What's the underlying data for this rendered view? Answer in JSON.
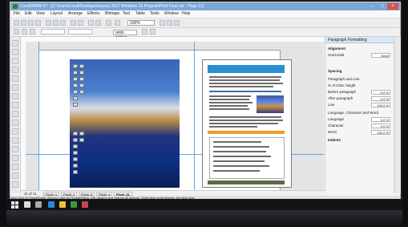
{
  "window": {
    "title": "CorelDRAW X7 - [C:\\Users\\Local\\Desktop\\January 2017 Windows 10 Projects\\Print Final.cdr - Page 11]"
  },
  "menus": [
    "File",
    "Edit",
    "View",
    "Layout",
    "Arrange",
    "Effects",
    "Bitmaps",
    "Text",
    "Table",
    "Tools",
    "Window",
    "Help"
  ],
  "toolbar": {
    "zoom": "100%"
  },
  "property_bar": {
    "units": "units: inches"
  },
  "page_tabs": [
    "Page 1",
    "Page 2",
    "Page 3",
    "Page 4",
    "Page 11"
  ],
  "page_counter": "11 of 11",
  "panel": {
    "title": "Paragraph Formatting",
    "sections": [
      {
        "label": "Alignment"
      },
      {
        "label": "Horizontal",
        "value": "None"
      },
      {
        "label": "Spacing"
      },
      {
        "label": "Paragraph and Line"
      },
      {
        "label": "% of Char. height"
      },
      {
        "label": "Before paragraph",
        "value": "0.0 %"
      },
      {
        "label": "After paragraph",
        "value": "0.0 %"
      },
      {
        "label": "Line",
        "value": "100.0 %"
      },
      {
        "label": "Language, Character and Word"
      },
      {
        "label": "Language",
        "value": "0.0 %"
      },
      {
        "label": "Character",
        "value": "0.0 %"
      },
      {
        "label": "Word",
        "value": "100.0 %"
      },
      {
        "label": "Indents"
      }
    ]
  },
  "status": {
    "text": "Next click for Drag/Scale; Second click for Rotate/Skew; Dbl-clicking tool selects all objects; Shift+click multi-selects; Alt+click digs"
  },
  "colors": {
    "titlebar": "#7aa7d6",
    "banner": "#2a8fd0",
    "accent_orange": "#f39a27",
    "taskbar": "#121317"
  }
}
